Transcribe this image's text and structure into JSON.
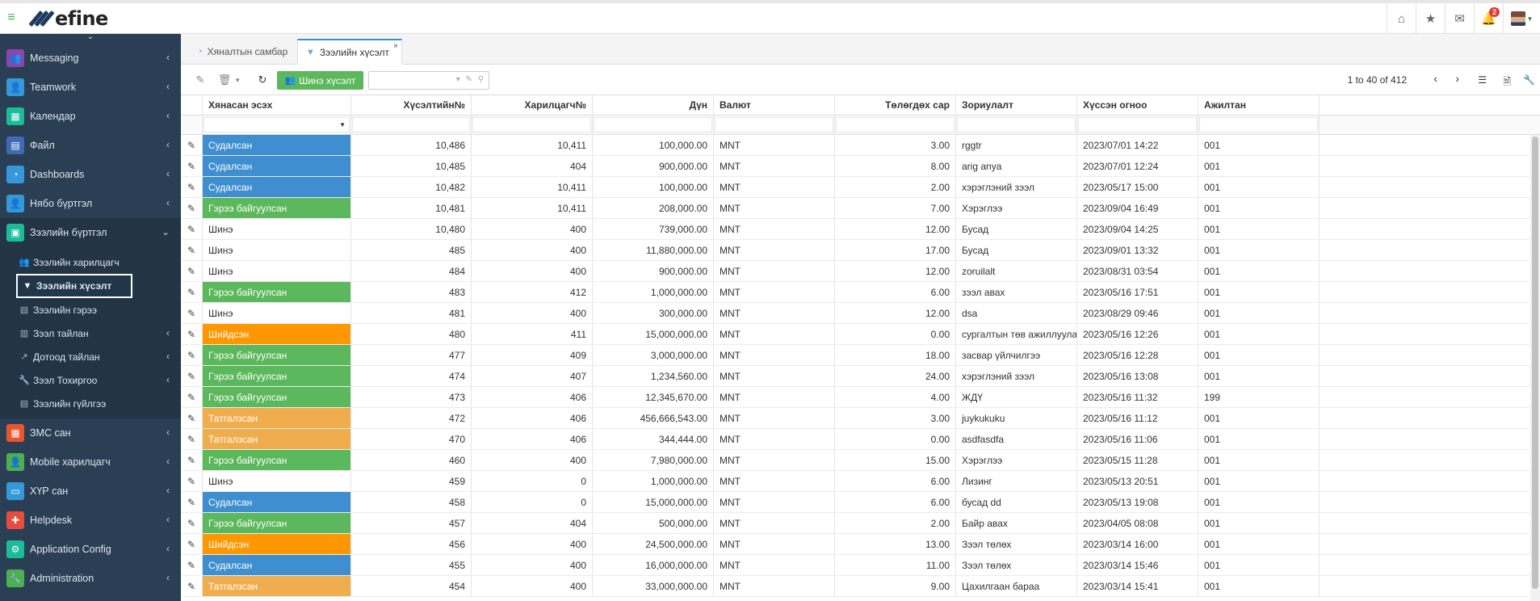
{
  "topbar": {
    "logo_text": "efine",
    "notification_count": "2",
    "icons": [
      "home-icon",
      "star-icon",
      "envelope-icon",
      "bell-icon",
      "avatar"
    ]
  },
  "sidebar": {
    "items": [
      {
        "label": "Messaging",
        "color": "#8e44ad",
        "icon": "users-icon"
      },
      {
        "label": "Teamwork",
        "color": "#3498db",
        "icon": "user-icon"
      },
      {
        "label": "Календар",
        "color": "#1abc9c",
        "icon": "calendar-icon"
      },
      {
        "label": "Файл",
        "color": "#3f6bb5",
        "icon": "file-icon"
      },
      {
        "label": "Dashboards",
        "color": "#3498db",
        "icon": "dashboard-icon"
      },
      {
        "label": "Нябо бүртгэл",
        "color": "#3498db",
        "icon": "user-icon"
      },
      {
        "label": "Зээлийн бүртгэл",
        "color": "#1abc9c",
        "icon": "money-icon"
      }
    ],
    "subitems": [
      {
        "label": "Зээлийн харилцагч",
        "icon": "users-icon"
      },
      {
        "label": "Зээлийн хүсэлт",
        "icon": "filter-icon"
      },
      {
        "label": "Зээлийн гэрээ",
        "icon": "file-icon"
      },
      {
        "label": "Зээл тайлан",
        "icon": "bar-chart-icon"
      },
      {
        "label": "Дотоод тайлан",
        "icon": "line-chart-icon"
      },
      {
        "label": "Зээл Тохиргоо",
        "icon": "wrench-icon"
      },
      {
        "label": "Зээлийн гүйлгээ",
        "icon": "file-icon"
      }
    ],
    "bottom_items": [
      {
        "label": "ЗМС сан",
        "color": "#e8562e",
        "icon": "table-icon"
      },
      {
        "label": "Mobile харилцагч",
        "color": "#4caf50",
        "icon": "user-icon"
      },
      {
        "label": "ХҮР сан",
        "color": "#3498db",
        "icon": "id-card-icon"
      },
      {
        "label": "Helpdesk",
        "color": "#e74c3c",
        "icon": "lifebuoy-icon"
      },
      {
        "label": "Application Config",
        "color": "#1abc9c",
        "icon": "gear-icon"
      },
      {
        "label": "Administration",
        "color": "#4caf50",
        "icon": "wrench-icon"
      }
    ]
  },
  "tabs": [
    {
      "label": "Хяналтын самбар",
      "icon": "dashboard-icon"
    },
    {
      "label": "Зээлийн хүсэлт",
      "icon": "filter-icon",
      "close": "×"
    }
  ],
  "toolbar": {
    "new_button": "Шинэ хүсэлт",
    "search_placeholder": "",
    "pager_text": "1 to 40 of 412"
  },
  "grid": {
    "columns": [
      "Хянасан эсэх",
      "Хүсэлтийн№",
      "Харилцагч№",
      "Дүн",
      "Валют",
      "Төлөгдөх сар",
      "Зориулалт",
      "Хүссэн огноо",
      "Ажилтан"
    ],
    "rows": [
      {
        "status": "Судалсан",
        "color": "blue",
        "req": "10,486",
        "cust": "10,411",
        "amount": "100,000.00",
        "currency": "MNT",
        "months": "3.00",
        "purpose": "rggtr",
        "date": "2023/07/01 14:22",
        "emp": "001"
      },
      {
        "status": "Судалсан",
        "color": "blue",
        "req": "10,485",
        "cust": "404",
        "amount": "900,000.00",
        "currency": "MNT",
        "months": "8.00",
        "purpose": "arig anya",
        "date": "2023/07/01 12:24",
        "emp": "001"
      },
      {
        "status": "Судалсан",
        "color": "blue",
        "req": "10,482",
        "cust": "10,411",
        "amount": "100,000.00",
        "currency": "MNT",
        "months": "2.00",
        "purpose": "хэрэглэний зээл",
        "date": "2023/05/17 15:00",
        "emp": "001"
      },
      {
        "status": "Гэрээ байгуулсан",
        "color": "green",
        "req": "10,481",
        "cust": "10,411",
        "amount": "208,000.00",
        "currency": "MNT",
        "months": "7.00",
        "purpose": "Хэрэглээ",
        "date": "2023/09/04 16:49",
        "emp": "001"
      },
      {
        "status": "Шинэ",
        "color": "none",
        "req": "10,480",
        "cust": "400",
        "amount": "739,000.00",
        "currency": "MNT",
        "months": "12.00",
        "purpose": "Бусад",
        "date": "2023/09/04 14:25",
        "emp": "001"
      },
      {
        "status": "Шинэ",
        "color": "none",
        "req": "485",
        "cust": "400",
        "amount": "11,880,000.00",
        "currency": "MNT",
        "months": "17.00",
        "purpose": "Бусад",
        "date": "2023/09/01 13:32",
        "emp": "001"
      },
      {
        "status": "Шинэ",
        "color": "none",
        "req": "484",
        "cust": "400",
        "amount": "900,000.00",
        "currency": "MNT",
        "months": "12.00",
        "purpose": "zoruilalt",
        "date": "2023/08/31 03:54",
        "emp": "001"
      },
      {
        "status": "Гэрээ байгуулсан",
        "color": "green",
        "req": "483",
        "cust": "412",
        "amount": "1,000,000.00",
        "currency": "MNT",
        "months": "6.00",
        "purpose": "зээл авах",
        "date": "2023/05/16 17:51",
        "emp": "001"
      },
      {
        "status": "Шинэ",
        "color": "none",
        "req": "481",
        "cust": "400",
        "amount": "300,000.00",
        "currency": "MNT",
        "months": "12.00",
        "purpose": "dsa",
        "date": "2023/08/29 09:46",
        "emp": "001"
      },
      {
        "status": "Шийдсэн",
        "color": "orange",
        "req": "480",
        "cust": "411",
        "amount": "15,000,000.00",
        "currency": "MNT",
        "months": "0.00",
        "purpose": "сургалтын төв ажиллуулах",
        "date": "2023/05/16 12:26",
        "emp": "001"
      },
      {
        "status": "Гэрээ байгуулсан",
        "color": "green",
        "req": "477",
        "cust": "409",
        "amount": "3,000,000.00",
        "currency": "MNT",
        "months": "18.00",
        "purpose": "засвар үйлчилгээ",
        "date": "2023/05/16 12:28",
        "emp": "001"
      },
      {
        "status": "Гэрээ байгуулсан",
        "color": "green",
        "req": "474",
        "cust": "407",
        "amount": "1,234,560.00",
        "currency": "MNT",
        "months": "24.00",
        "purpose": "хэрэглэний зээл",
        "date": "2023/05/16 13:08",
        "emp": "001"
      },
      {
        "status": "Гэрээ байгуулсан",
        "color": "green",
        "req": "473",
        "cust": "406",
        "amount": "12,345,670.00",
        "currency": "MNT",
        "months": "4.00",
        "purpose": "ЖДҮ",
        "date": "2023/05/16 11:32",
        "emp": "199"
      },
      {
        "status": "Татгалзсан",
        "color": "lorange",
        "req": "472",
        "cust": "406",
        "amount": "456,666,543.00",
        "currency": "MNT",
        "months": "3.00",
        "purpose": "juykukuku",
        "date": "2023/05/16 11:12",
        "emp": "001"
      },
      {
        "status": "Татгалзсан",
        "color": "lorange",
        "req": "470",
        "cust": "406",
        "amount": "344,444.00",
        "currency": "MNT",
        "months": "0.00",
        "purpose": "asdfasdfa",
        "date": "2023/05/16 11:06",
        "emp": "001"
      },
      {
        "status": "Гэрээ байгуулсан",
        "color": "green",
        "req": "460",
        "cust": "400",
        "amount": "7,980,000.00",
        "currency": "MNT",
        "months": "15.00",
        "purpose": "Хэрэглээ",
        "date": "2023/05/15 11:28",
        "emp": "001"
      },
      {
        "status": "Шинэ",
        "color": "none",
        "req": "459",
        "cust": "0",
        "amount": "1,000,000.00",
        "currency": "MNT",
        "months": "6.00",
        "purpose": "Лизинг",
        "date": "2023/05/13 20:51",
        "emp": "001"
      },
      {
        "status": "Судалсан",
        "color": "blue",
        "req": "458",
        "cust": "0",
        "amount": "15,000,000.00",
        "currency": "MNT",
        "months": "6.00",
        "purpose": "бусад dd",
        "date": "2023/05/13 19:08",
        "emp": "001"
      },
      {
        "status": "Гэрээ байгуулсан",
        "color": "green",
        "req": "457",
        "cust": "404",
        "amount": "500,000.00",
        "currency": "MNT",
        "months": "2.00",
        "purpose": "Байр авах",
        "date": "2023/04/05 08:08",
        "emp": "001"
      },
      {
        "status": "Шийдсэн",
        "color": "orange",
        "req": "456",
        "cust": "400",
        "amount": "24,500,000.00",
        "currency": "MNT",
        "months": "13.00",
        "purpose": "Зээл төлөх",
        "date": "2023/03/14 16:00",
        "emp": "001"
      },
      {
        "status": "Судалсан",
        "color": "blue",
        "req": "455",
        "cust": "400",
        "amount": "16,000,000.00",
        "currency": "MNT",
        "months": "11.00",
        "purpose": "Зээл төлөх",
        "date": "2023/03/14 15:46",
        "emp": "001"
      },
      {
        "status": "Татгалзсан",
        "color": "lorange",
        "req": "454",
        "cust": "400",
        "amount": "33,000,000.00",
        "currency": "MNT",
        "months": "9.00",
        "purpose": "Цахилгаан бараа",
        "date": "2023/03/14 15:41",
        "emp": "001"
      }
    ]
  }
}
